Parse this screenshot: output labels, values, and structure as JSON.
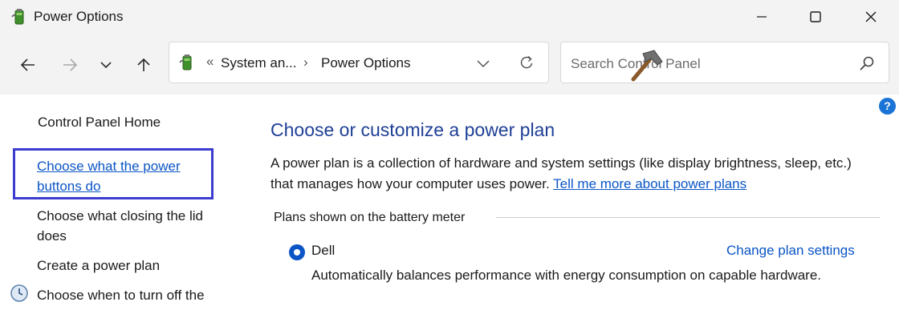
{
  "window": {
    "title": "Power Options"
  },
  "navbar": {
    "breadcrumb_overflow": "«",
    "crumbs": [
      "System an...",
      "Power Options"
    ],
    "separator": "›",
    "search_placeholder": "Search Control Panel"
  },
  "sidebar": {
    "home": "Control Panel Home",
    "items": [
      {
        "label_line1": "Choose what the power",
        "label_line2": "buttons do"
      },
      {
        "label_line1": "Choose what closing the lid",
        "label_line2": "does"
      },
      {
        "label": "Create a power plan"
      },
      {
        "label": "Choose when to turn off the"
      }
    ]
  },
  "main": {
    "heading": "Choose or customize a power plan",
    "description_line1": "A power plan is a collection of hardware and system settings (like display brightness, sleep, etc.)",
    "description_line2": "that manages how your computer uses power.",
    "learn_more": "Tell me more about power plans",
    "group_label": "Plans shown on the battery meter",
    "plan": {
      "name": "Dell",
      "selected": true,
      "change_link": "Change plan settings",
      "description": "Automatically balances performance with energy consumption on capable hardware."
    }
  },
  "help": {
    "label": "?"
  },
  "colors": {
    "accent": "#0a55c6",
    "heading": "#1f3f96",
    "focus_box": "#3c3ccf"
  },
  "icons": [
    "power-options-icon",
    "minimize-icon",
    "maximize-icon",
    "close-icon",
    "back-icon",
    "forward-icon",
    "recent-locations-icon",
    "up-icon",
    "chevron-down-icon",
    "refresh-icon",
    "hammer-icon",
    "search-icon",
    "help-icon",
    "clock-icon"
  ]
}
